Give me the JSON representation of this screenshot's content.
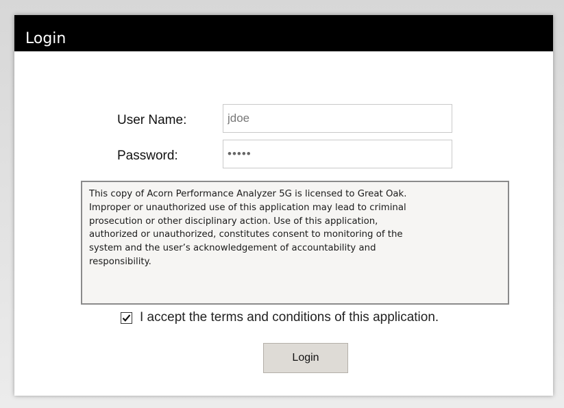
{
  "dialog": {
    "title": "Login"
  },
  "form": {
    "username_label": "User Name:",
    "username_value": "jdoe",
    "password_label": "Password:",
    "password_value": "•••••"
  },
  "notice": {
    "text": "This copy of Acorn Performance Analyzer 5G is licensed to Great Oak.\nImproper or unauthorized use of this application may lead to criminal\nprosecution or other disciplinary action. Use of this application,\nauthorized or unauthorized, constitutes consent to monitoring of the\nsystem and the user’s acknowledgement of accountability and\nresponsibility."
  },
  "terms": {
    "checked": true,
    "label": "I accept the terms and conditions of this application."
  },
  "actions": {
    "login_label": "Login"
  },
  "colors": {
    "titlebar": "#000000",
    "button": "#dedbd6",
    "notice_border": "#8a8a8a"
  }
}
